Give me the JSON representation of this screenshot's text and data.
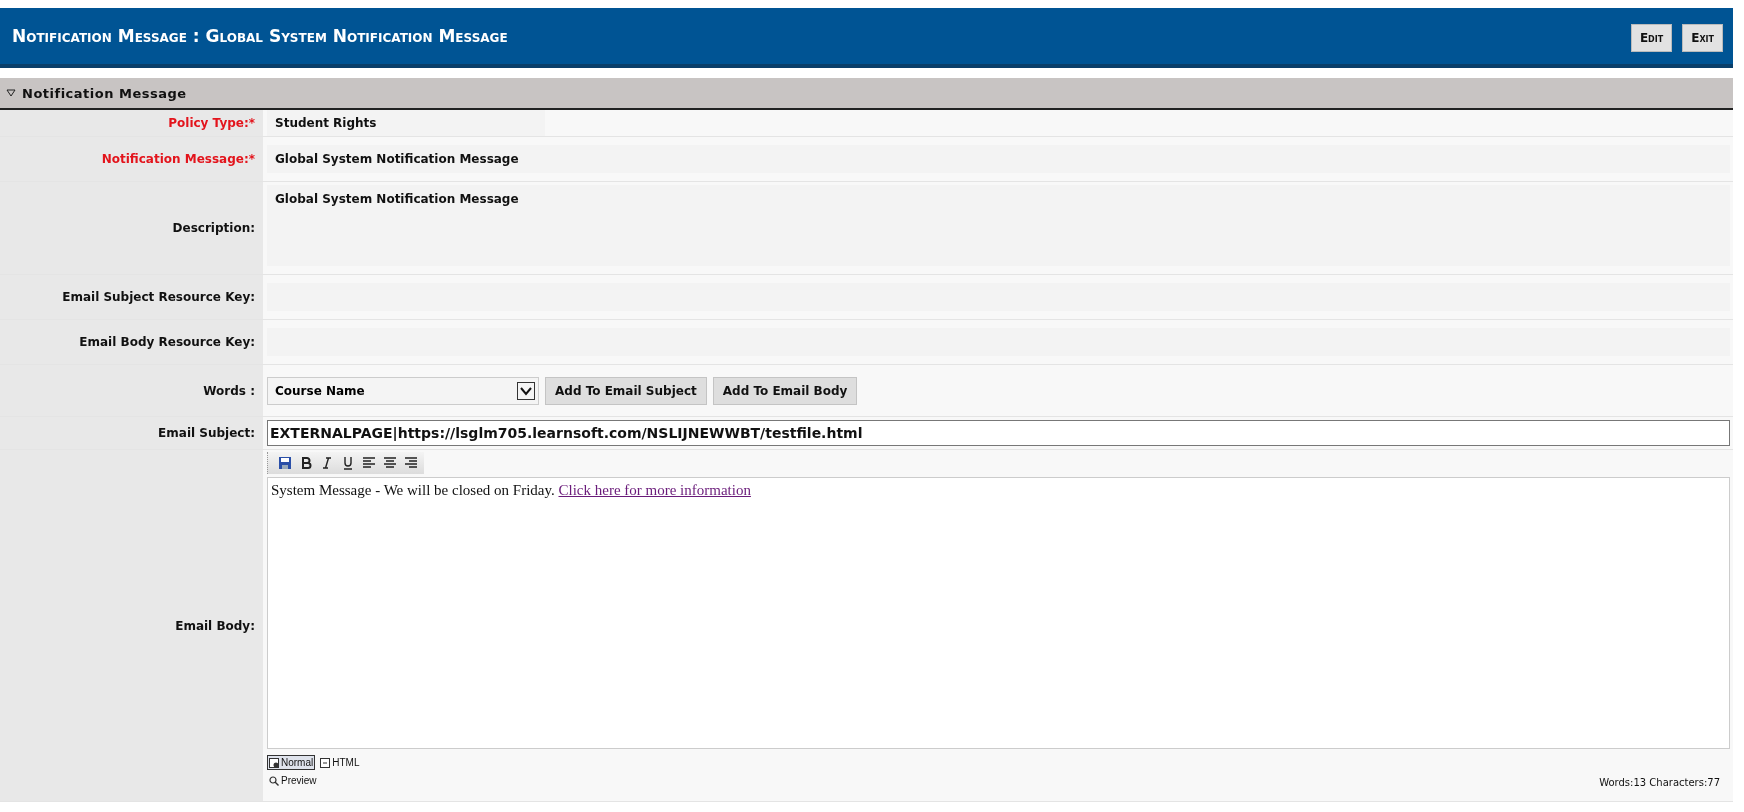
{
  "header": {
    "title": "Notification Message : Global System Notification Message",
    "buttons": [
      {
        "label": "Edit"
      },
      {
        "label": "Exit"
      }
    ]
  },
  "section": {
    "title": "Notification Message",
    "expanded": true
  },
  "fields": [
    {
      "kind": "choice",
      "label": "Policy Type:*",
      "required": true,
      "value": "Student Rights"
    },
    {
      "kind": "readonly",
      "label": "Notification Message:*",
      "required": true,
      "value": "Global System Notification Message"
    },
    {
      "kind": "textarea",
      "label": "Description:",
      "required": false,
      "value": "Global System Notification Message"
    },
    {
      "kind": "readonly",
      "label": "Email Subject Resource Key:",
      "required": false
    },
    {
      "kind": "readonly",
      "label": "Email Body Resource Key:",
      "required": false
    },
    {
      "kind": "words",
      "label": "Words :",
      "required": false,
      "value": "Course Name",
      "buttons": [
        "Add To Email Subject",
        "Add To Email Body"
      ]
    },
    {
      "kind": "input",
      "label": "Email Subject:",
      "required": false,
      "value": "EXTERNALPAGE|https://lsglm705.learnsoft.com/NSLIJNEWWBT/testfile.html"
    },
    {
      "kind": "editor",
      "label": "Email Body:",
      "required": false,
      "text": "System Message - We will be closed on Friday. ",
      "link": "Click here for more information",
      "modes": [
        {
          "label": "Normal",
          "selected": true
        },
        {
          "label": "HTML",
          "selected": false
        }
      ],
      "preview": "Preview",
      "stats": "Words:13 Characters:77"
    }
  ]
}
